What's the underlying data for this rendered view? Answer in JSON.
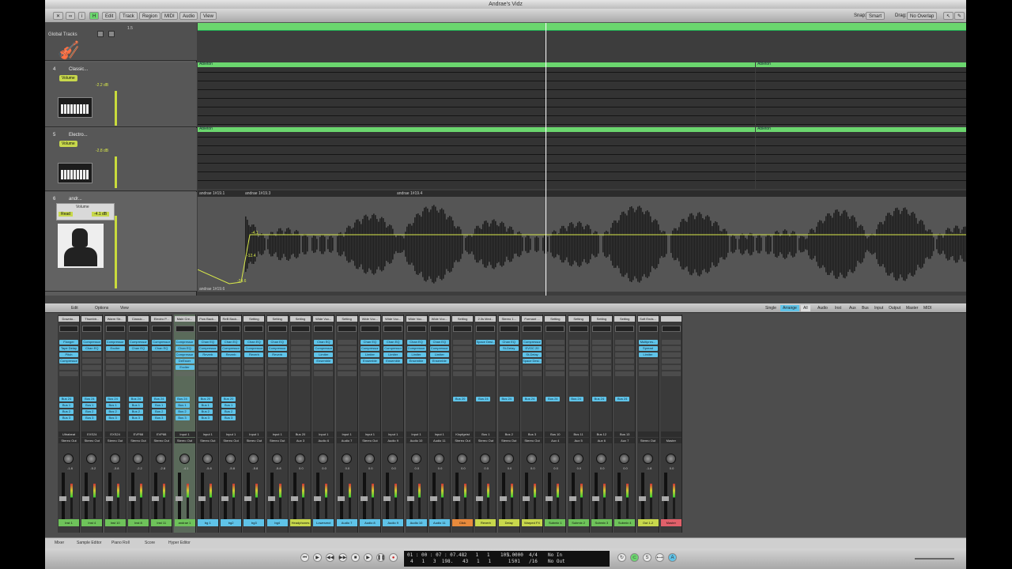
{
  "window": {
    "title": "Andrae's Vidz"
  },
  "toolbar": {
    "items": [
      "Edit",
      "Track",
      "Region",
      "MIDI",
      "Audio",
      "View"
    ],
    "snap_label": "Snap:",
    "snap_value": "Smart",
    "drag_label": "Drag:",
    "drag_value": "No Overlap"
  },
  "arrange": {
    "global_tracks": "Global Tracks",
    "ruler_marker": "1.5",
    "tracks": [
      {
        "num": "4",
        "name": "Classic...",
        "volume_label": "Volume",
        "volume_value": "-2.2 dB"
      },
      {
        "num": "5",
        "name": "Electro...",
        "volume_label": "Volume",
        "volume_value": "-2.8 dB"
      },
      {
        "num": "6",
        "name": "andr...",
        "volume_label": "Volume",
        "mode": "Read",
        "volume_value": "-4.1 dB"
      }
    ],
    "regions": [
      {
        "label": "Ableton"
      },
      {
        "label": "Ableton"
      },
      {
        "label": "Ableton"
      },
      {
        "label": "Ableton"
      }
    ],
    "audio_regions": [
      "andrae 1#19.1",
      "andrae 1#19.3",
      "andrae 1#19.4"
    ],
    "automation": [
      "-4.1",
      "-12.4",
      "-24.6"
    ],
    "audio_footer": "andrae 1#19.6"
  },
  "mixer": {
    "toolbar": {
      "edit": "Edit",
      "options": "Options",
      "view": "View",
      "single": "Single",
      "arrange": "Arrange",
      "all": "All",
      "filters": [
        "Audio",
        "Inst",
        "Aux",
        "Bus",
        "Input",
        "Output",
        "Master",
        "MIDI"
      ]
    },
    "strips": [
      {
        "top": "Downto...",
        "plug": [
          "Flanger",
          "Tape Delay",
          "Pitch",
          "Compressor"
        ],
        "sends": [
          "Bus 24",
          "Bus 1",
          "Bus 2",
          "Bus 3"
        ],
        "io1": "Ultrabeat",
        "io2": "Stereo Out",
        "gain": "-1.8",
        "name": "Inst 1",
        "color": "#6ec35a"
      },
      {
        "top": "Thumbtr...",
        "plug": [
          "Compressor",
          "Chan EQ"
        ],
        "sends": [
          "Bus 24",
          "Bus 1",
          "Bus 2",
          "Bus 3"
        ],
        "io1": "EXS24",
        "io2": "Stereo Out",
        "gain": "-5.2",
        "name": "Inst 4",
        "color": "#6ec35a"
      },
      {
        "top": "Warm Str...",
        "plug": [
          "Compressor",
          "Exciter"
        ],
        "sends": [
          "Bus 24",
          "Bus 1",
          "Bus 2",
          "Bus 3"
        ],
        "io1": "EXS24",
        "io2": "Stereo Out",
        "gain": "-3.8",
        "name": "Inst 10",
        "color": "#6ec35a"
      },
      {
        "top": "Classic...",
        "plug": [
          "Compressor",
          "Chan EQ"
        ],
        "sends": [
          "Bus 24",
          "Bus 1",
          "Bus 2",
          "Bus 3"
        ],
        "io1": "EVP88",
        "io2": "Stereo Out",
        "gain": "-2.2",
        "name": "Inst 8",
        "color": "#6ec35a"
      },
      {
        "top": "Electro P...",
        "plug": [
          "Compressor",
          "Chan EQ"
        ],
        "sends": [
          "Bus 24",
          "Bus 1",
          "Bus 2",
          "Bus 3"
        ],
        "io1": "EVP88",
        "io2": "Stereo Out",
        "gain": "-2.8",
        "name": "Inst 11",
        "color": "#6ec35a"
      },
      {
        "top": "Main Cre...",
        "plug": [
          "Compressor",
          "Chan EQ",
          "Compressor",
          "DeEsser",
          "Exciter"
        ],
        "sends": [
          "Bus 24",
          "Bus 1",
          "Bus 2",
          "Bus 3"
        ],
        "io1": "Input 1",
        "io2": "Stereo Out",
        "gain": "-4.1",
        "name": "andrae 1",
        "color": "#6ec35a",
        "selected": true
      },
      {
        "top": "Pow Back...",
        "plug": [
          "Chan EQ",
          "Compressor",
          "Reverb"
        ],
        "sends": [
          "Bus 20",
          "Bus 1",
          "Bus 2",
          "Bus 3"
        ],
        "io1": "Input 1",
        "io2": "Stereo Out",
        "gain": "-5.8",
        "name": "bg 1",
        "color": "#5fc3e8"
      },
      {
        "top": "ReB Back...",
        "plug": [
          "Chan EQ",
          "Compressor",
          "Reverb"
        ],
        "sends": [
          "Bus 20",
          "Bus 1",
          "Bus 2",
          "Bus 3"
        ],
        "io1": "Input 1",
        "io2": "Stereo Out",
        "gain": "-5.8",
        "name": "bg2",
        "color": "#5fc3e8"
      },
      {
        "top": "Setting",
        "plug": [
          "Chan EQ",
          "Compressor",
          "Reverb"
        ],
        "sends": [],
        "io1": "Input 1",
        "io2": "Stereo Out",
        "gain": "-5.8",
        "name": "bg3",
        "color": "#5fc3e8"
      },
      {
        "top": "Setting",
        "plug": [
          "Chan EQ",
          "Compressor",
          "Reverb"
        ],
        "sends": [],
        "io1": "Input 1",
        "io2": "Stereo Out",
        "gain": "-5.8",
        "name": "bg4",
        "color": "#5fc3e8"
      },
      {
        "top": "Setting",
        "plug": [],
        "sends": [],
        "io1": "Bus 20",
        "io2": "Aux 3",
        "gain": "0.0",
        "name": "Headphones",
        "color": "#c8d84c"
      },
      {
        "top": "Wide Voc...",
        "plug": [
          "Chan EQ",
          "Compressor",
          "Limiter",
          "Ensemble"
        ],
        "sends": [],
        "io1": "Input 1",
        "io2": "Audio 6",
        "gain": "0.0",
        "name": "Lowerzect",
        "color": "#5fc3e8"
      },
      {
        "top": "Setting",
        "plug": [],
        "sends": [],
        "io1": "Input 1",
        "io2": "Audio 7",
        "gain": "0.0",
        "name": "Audio 7",
        "color": "#5fc3e8"
      },
      {
        "top": "Wide Voc...",
        "plug": [
          "Chan EQ",
          "Compressor",
          "Limiter",
          "Ensemble"
        ],
        "sends": [],
        "io1": "Input 1",
        "io2": "Stereo Out",
        "gain": "0.0",
        "name": "Audio 8",
        "color": "#5fc3e8"
      },
      {
        "top": "Wide Voc...",
        "plug": [
          "Chan EQ",
          "Compressor",
          "Limiter",
          "Ensemble"
        ],
        "sends": [],
        "io1": "Input 1",
        "io2": "Audio 9",
        "gain": "0.0",
        "name": "Audio 9",
        "color": "#5fc3e8"
      },
      {
        "top": "Wide Voc...",
        "plug": [
          "Chan EQ",
          "Compressor",
          "Limiter",
          "Ensemble"
        ],
        "sends": [],
        "io1": "Input 1",
        "io2": "Audio 10",
        "gain": "0.0",
        "name": "Audio 10",
        "color": "#5fc3e8"
      },
      {
        "top": "Wide Voc...",
        "plug": [
          "Chan EQ",
          "Compressor",
          "Limiter",
          "Ensemble"
        ],
        "sends": [],
        "io1": "Input 1",
        "io2": "Audio 11",
        "gain": "0.0",
        "name": "Audio 11",
        "color": "#5fc3e8"
      },
      {
        "top": "Setting",
        "plug": [],
        "sends": [
          "Bus 20"
        ],
        "io1": "Klopfgeist",
        "io2": "Stereo Out",
        "gain": "0.0",
        "name": "Click",
        "color": "#e88a3c"
      },
      {
        "top": "2.0s Med...",
        "plug": [
          "Space Desi..."
        ],
        "sends": [
          "Bus 24"
        ],
        "io1": "Bus 1",
        "io2": "Stereo Out",
        "gain": "0.0",
        "name": "Reverb",
        "color": "#c8d84c"
      },
      {
        "top": "Stereo 1...",
        "plug": [
          "Chan EQ",
          "St-Delay"
        ],
        "sends": [
          "Bus 24"
        ],
        "io1": "Bus 2",
        "io2": "Stereo Out",
        "gain": "0.0",
        "name": "Delay",
        "color": "#c8d84c"
      },
      {
        "top": "Formant ...",
        "plug": [
          "Compressor",
          "EVOC 20",
          "St-Delay",
          "Space Desi..."
        ],
        "sends": [
          "Bus 24"
        ],
        "io1": "Bus 3",
        "io2": "Stereo Out",
        "gain": "0.0",
        "name": "Warped FX",
        "color": "#c8d84c"
      },
      {
        "top": "Setting",
        "plug": [],
        "sends": [
          "Bus 24"
        ],
        "io1": "Bus 10",
        "io2": "Aux 4",
        "gain": "0.0",
        "name": "Submix 1",
        "color": "#6ec35a"
      },
      {
        "top": "Setting",
        "plug": [],
        "sends": [
          "Bus 24"
        ],
        "io1": "Bus 11",
        "io2": "Aux 5",
        "gain": "0.0",
        "name": "Submix 2",
        "color": "#6ec35a"
      },
      {
        "top": "Setting",
        "plug": [],
        "sends": [
          "Bus 24"
        ],
        "io1": "Bus 12",
        "io2": "Aux 6",
        "gain": "0.0",
        "name": "Submix 3",
        "color": "#6ec35a"
      },
      {
        "top": "Setting",
        "plug": [],
        "sends": [
          "Bus 24"
        ],
        "io1": "Bus 13",
        "io2": "Aux 7",
        "gain": "0.0",
        "name": "Submix 4",
        "color": "#6ec35a"
      },
      {
        "top": "Soft Ends...",
        "plug": [
          "Multipres...",
          "Spread",
          "Limiter"
        ],
        "sends": [],
        "io1": "",
        "io2": "Stereo Out",
        "gain": "-1.8",
        "name": "Out 1-2",
        "color": "#c8d84c"
      },
      {
        "top": "",
        "plug": [],
        "sends": [],
        "io1": "",
        "io2": "Master",
        "gain": "0.0",
        "name": "Master",
        "color": "#e0606a"
      }
    ]
  },
  "tabs": [
    "Mixer",
    "Sample Editor",
    "Piano Roll",
    "Score",
    "Hyper Editor"
  ],
  "transport": {
    "smpte": "01 : 00 : 07 : 07.48",
    "smpte_sub": "4   1   3  198.",
    "bars": "2   1   1      1",
    "bars_sub": "43   1   1      1",
    "tempo": "105.0000",
    "tempo_sub": "501",
    "sig": "4/4",
    "sig_sub": "/16",
    "in": "No In",
    "out": "No Out"
  }
}
